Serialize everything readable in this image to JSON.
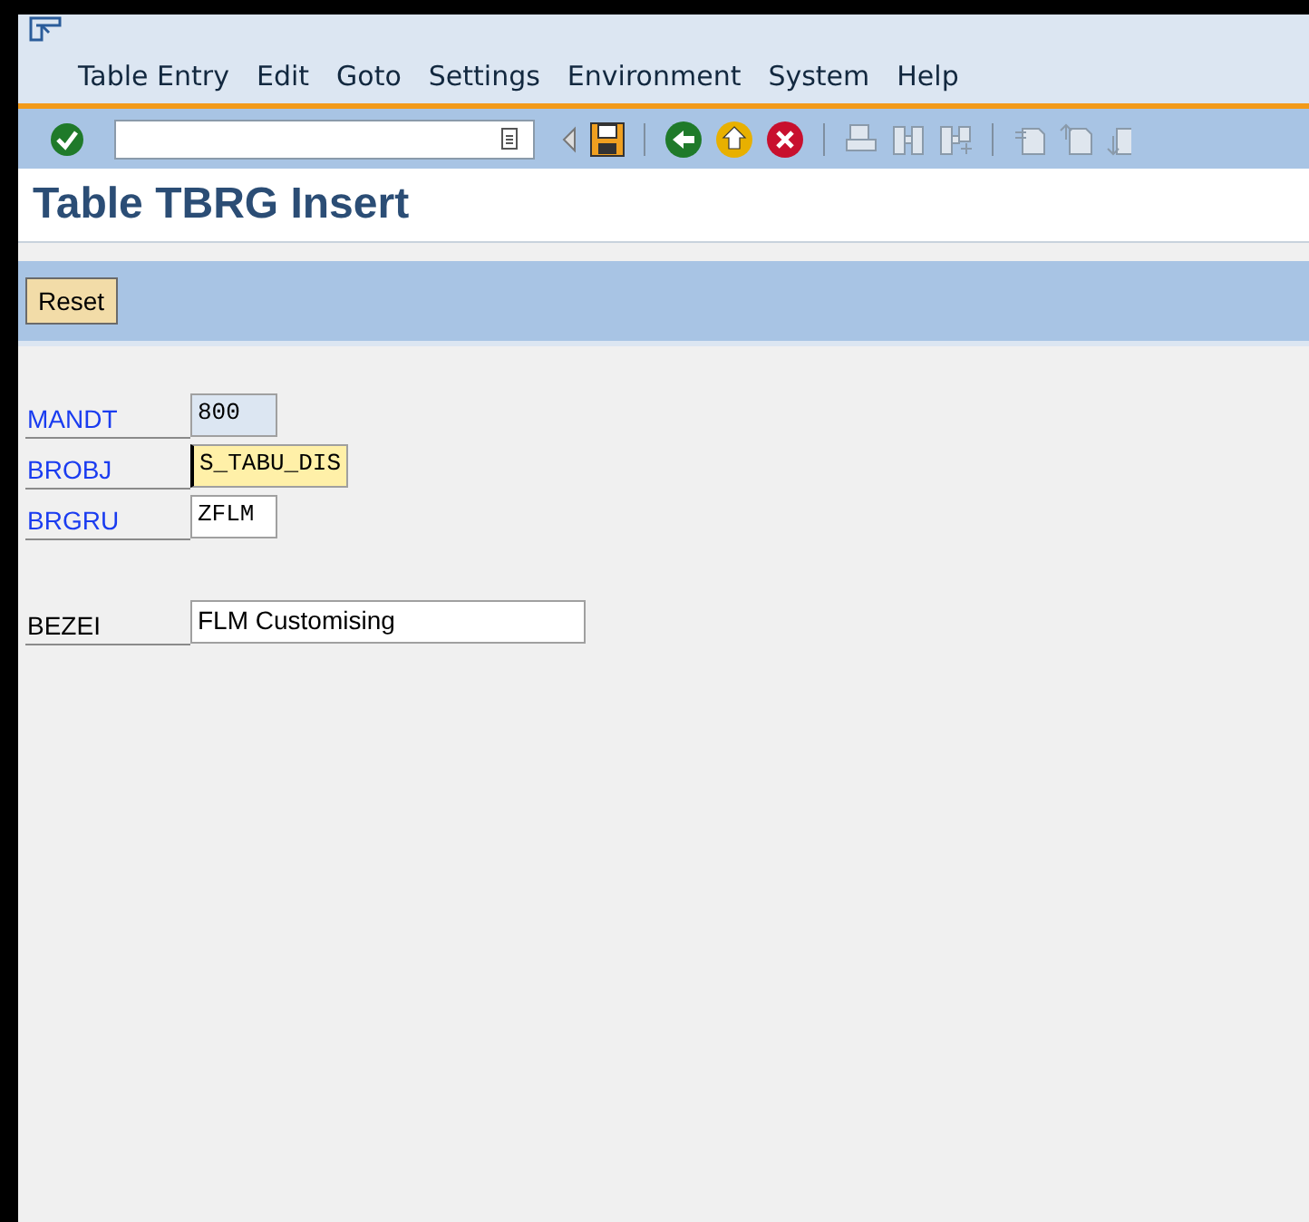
{
  "menu": [
    {
      "label": "Table Entry"
    },
    {
      "label": "Edit"
    },
    {
      "label": "Goto"
    },
    {
      "label": "Settings"
    },
    {
      "label": "Environment"
    },
    {
      "label": "System"
    },
    {
      "label": "Help"
    }
  ],
  "title": "Table TBRG Insert",
  "app_toolbar": {
    "buttons": [
      "Reset"
    ]
  },
  "fields": [
    {
      "label": "MANDT",
      "key": true,
      "value": "800",
      "readonly": true,
      "focused": false
    },
    {
      "label": "BROBJ",
      "key": true,
      "value": "S_TABU_DIS",
      "readonly": false,
      "focused": true
    },
    {
      "label": "BRGRU",
      "key": true,
      "value": "ZFLM",
      "readonly": false,
      "focused": false
    },
    {
      "label": "BEZEI",
      "key": false,
      "value": "FLM Customising",
      "readonly": false,
      "focused": false
    }
  ]
}
